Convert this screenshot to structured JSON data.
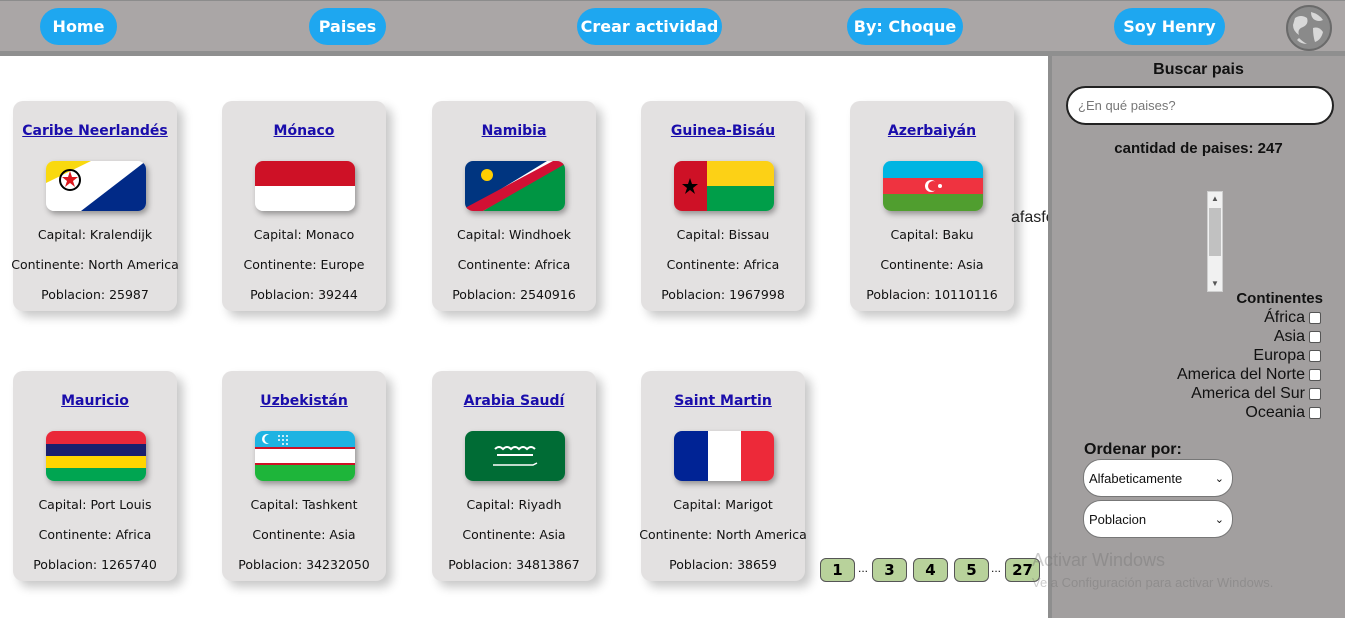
{
  "nav": {
    "home": "Home",
    "paises": "Paises",
    "crear": "Crear actividad",
    "by": "By: Choque",
    "henry": "Soy Henry",
    "logo": "globe-icon"
  },
  "cards": [
    {
      "name": "Caribe Neerlandés",
      "capital": "Capital: Kralendijk",
      "continente": "Continente: North America",
      "poblacion": "Poblacion: 25987",
      "flag": "bonaire-flag"
    },
    {
      "name": "Mónaco",
      "capital": "Capital: Monaco",
      "continente": "Continente: Europe",
      "poblacion": "Poblacion: 39244",
      "flag": "monaco-flag"
    },
    {
      "name": "Namibia",
      "capital": "Capital: Windhoek",
      "continente": "Continente: Africa",
      "poblacion": "Poblacion: 2540916",
      "flag": "namibia-flag"
    },
    {
      "name": "Guinea-Bisáu",
      "capital": "Capital: Bissau",
      "continente": "Continente: Africa",
      "poblacion": "Poblacion: 1967998",
      "flag": "guinea-bissau-flag"
    },
    {
      "name": "Azerbaiyán",
      "capital": "Capital: Baku",
      "continente": "Continente: Asia",
      "poblacion": "Poblacion: 10110116",
      "flag": "azerbaijan-flag"
    },
    {
      "name": "Mauricio",
      "capital": "Capital: Port Louis",
      "continente": "Continente: Africa",
      "poblacion": "Poblacion: 1265740",
      "flag": "mauritius-flag"
    },
    {
      "name": "Uzbekistán",
      "capital": "Capital: Tashkent",
      "continente": "Continente: Asia",
      "poblacion": "Poblacion: 34232050",
      "flag": "uzbekistan-flag"
    },
    {
      "name": "Arabia Saudí",
      "capital": "Capital: Riyadh",
      "continente": "Continente: Asia",
      "poblacion": "Poblacion: 34813867",
      "flag": "saudi-arabia-flag"
    },
    {
      "name": "Saint Martin",
      "capital": "Capital: Marigot",
      "continente": "Continente: North America",
      "poblacion": "Poblacion: 38659",
      "flag": "france-flag"
    }
  ],
  "pagination": {
    "pages": [
      "1",
      "3",
      "4",
      "5",
      "27"
    ],
    "ellipsis": "..."
  },
  "sidebar": {
    "title": "Buscar pais",
    "search_placeholder": "¿En qué paises?",
    "count_text": "cantidad de paises: 247",
    "continents_title": "Continentes",
    "continents": [
      "África",
      "Asia",
      "Europa",
      "America del Norte",
      "America del Sur",
      "Oceania"
    ],
    "order_title": "Ordenar por:",
    "order_select": "Alfabeticamente",
    "population_select": "Poblacion"
  },
  "stray_text": "afasfeer",
  "watermark": {
    "line1": "Activar Windows",
    "line2": "Ve a Configuración para activar Windows."
  }
}
